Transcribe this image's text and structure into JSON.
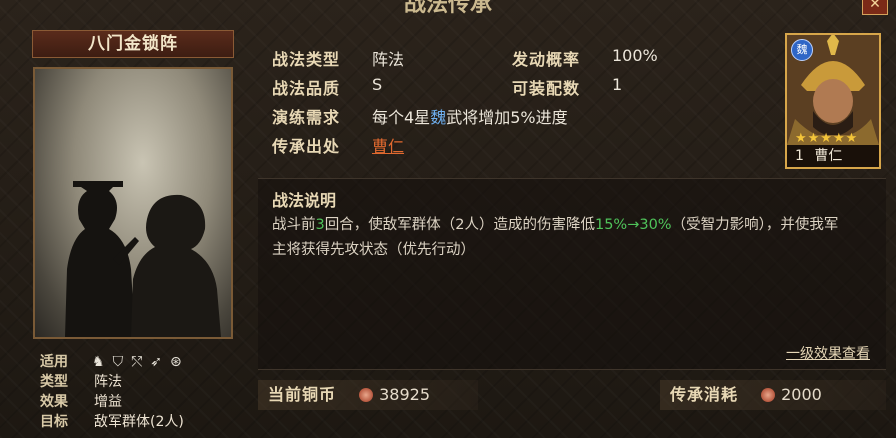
{
  "window": {
    "title": "战法传承",
    "close_label": "✕"
  },
  "skill": {
    "name": "八门金锁阵",
    "attrs": [
      {
        "key": "适用",
        "value": ""
      },
      {
        "key": "类型",
        "value": "阵法"
      },
      {
        "key": "效果",
        "value": "增益"
      },
      {
        "key": "目标",
        "value": "敌军群体(2人)"
      }
    ],
    "troop_icons": [
      "cavalry-icon",
      "shield-icon",
      "bow-icon",
      "spear-icon",
      "siege-icon"
    ]
  },
  "info": {
    "type_label": "战法类型",
    "type_value": "阵法",
    "quality_label": "战法品质",
    "quality_value": "S",
    "rate_label": "发动概率",
    "rate_value": "100%",
    "slots_label": "可装配数",
    "slots_value": "1",
    "req_label": "演练需求",
    "req_prefix": "每个4星",
    "req_faction": "魏",
    "req_suffix": "武将增加5%进度",
    "source_label": "传承出处",
    "source_value": "曹仁"
  },
  "general": {
    "faction": "魏",
    "stars": "★★★★★",
    "level": "1",
    "name": "曹仁"
  },
  "description": {
    "title": "战法说明",
    "p1": "战斗前",
    "p_rounds": "3",
    "p2": "回合，使敌军群体（2人）造成的伤害降低",
    "p_range": "15%→30%",
    "p3": "（受智力影响），并使我军主将获得先攻状态（优先行动）",
    "effects_link": "一级效果查看"
  },
  "currency": {
    "coins_label": "当前铜币",
    "coins_value": "38925",
    "cost_label": "传承消耗",
    "cost_value": "2000"
  }
}
